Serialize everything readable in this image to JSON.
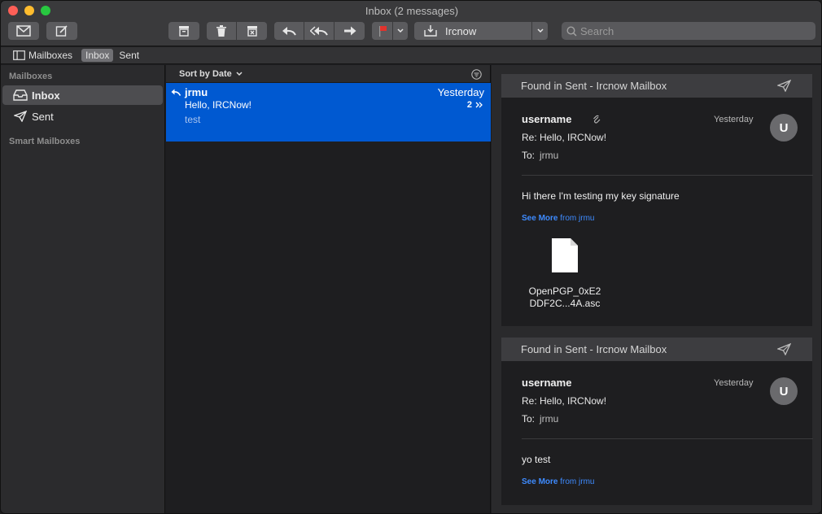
{
  "window": {
    "title": "Inbox (2 messages)"
  },
  "toolbar": {
    "mailbox_select": "Ircnow",
    "search_placeholder": "Search"
  },
  "favorites": {
    "mailboxes_label": "Mailboxes",
    "inbox_label": "Inbox",
    "sent_label": "Sent"
  },
  "sidebar": {
    "mailboxes_header": "Mailboxes",
    "items": [
      {
        "label": "Inbox",
        "icon": "inbox-tray-icon"
      },
      {
        "label": "Sent",
        "icon": "paper-plane-icon"
      }
    ],
    "smart_header": "Smart Mailboxes"
  },
  "list": {
    "sort_label": "Sort by Date",
    "messages": [
      {
        "from": "jrmu",
        "date": "Yesterday",
        "subject": "Hello, IRCNow!",
        "count": "2",
        "preview": "test"
      }
    ]
  },
  "viewer": {
    "cards": [
      {
        "header": "Found in Sent - Ircnow Mailbox",
        "sender": "username",
        "timestamp": "Yesterday",
        "avatar": "U",
        "subject": "Re: Hello, IRCNow!",
        "to_label": "To:",
        "to_value": "jrmu",
        "body": "Hi there I'm testing my key signature",
        "see_more": "See More",
        "see_more_from": "from jrmu",
        "attachment_line1": "OpenPGP_0xE2",
        "attachment_line2": "DDF2C...4A.asc"
      },
      {
        "header": "Found in Sent - Ircnow Mailbox",
        "sender": "username",
        "timestamp": "Yesterday",
        "avatar": "U",
        "subject": "Re: Hello, IRCNow!",
        "to_label": "To:",
        "to_value": "jrmu",
        "body": "yo test",
        "see_more": "See More",
        "see_more_from": "from jrmu"
      }
    ]
  },
  "colors": {
    "selection_blue": "#0059d1",
    "link_blue": "#3e8bff",
    "flag_red": "#e0332d"
  }
}
